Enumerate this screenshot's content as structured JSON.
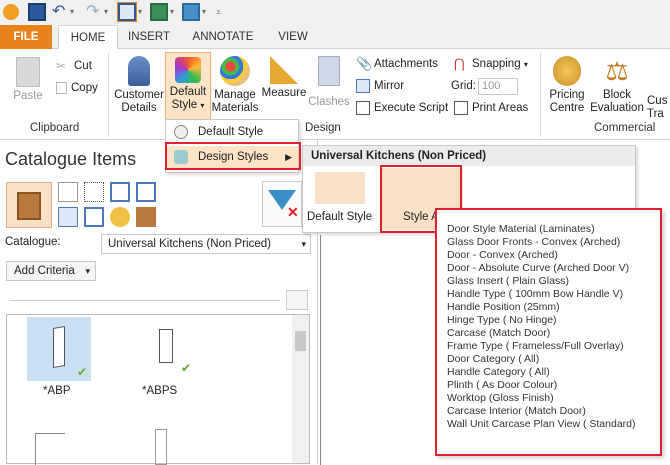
{
  "tabs": [
    "FILE",
    "HOME",
    "INSERT",
    "ANNOTATE",
    "VIEW"
  ],
  "clipboard": {
    "paste": "Paste",
    "cut": "Cut",
    "copy": "Copy",
    "group": "Clipboard"
  },
  "design": {
    "customer": [
      "Customer",
      "Details"
    ],
    "default_style": [
      "Default",
      "Style"
    ],
    "manage": [
      "Manage",
      "Materials"
    ],
    "measure": "Measure",
    "clashes": "Clashes",
    "attachments": "Attachments",
    "mirror": "Mirror",
    "execute": "Execute Script",
    "snapping": "Snapping",
    "grid_label": "Grid:",
    "grid_value": "100",
    "print": "Print Areas",
    "group": "Design"
  },
  "commercial": {
    "pricing": [
      "Pricing",
      "Centre"
    ],
    "block": [
      "Block",
      "Evaluation"
    ],
    "cut_off": [
      "Cus",
      "Tra"
    ],
    "group": "Commercial"
  },
  "left": {
    "title": "Catalogue Items",
    "catalogue_label": "Catalogue:",
    "catalogue_value": "Universal Kitchens (Non Priced)",
    "add_criteria": "Add Criteria",
    "items": [
      "*ABP",
      "*ABPS"
    ]
  },
  "dropdown": {
    "items": [
      "Default Style",
      "Design Styles"
    ]
  },
  "submenu": {
    "title": "Universal Kitchens (Non Priced)",
    "items": [
      "Default Style",
      "Style A"
    ]
  },
  "tooltip": {
    "lines": [
      "Door Style Material (Laminates)",
      "Glass Door Fronts - Convex (Arched)",
      "Door - Convex (Arched)",
      "Door - Absolute Curve (Arched Door V)",
      "Glass Insert (  Plain Glass)",
      "Handle Type ( 100mm Bow Handle V)",
      "Handle Position (25mm)",
      "Hinge Type ( No Hinge)",
      "Carcase (Match Door)",
      "Frame Type ( Frameless/Full Overlay)",
      "Door Category (  All)",
      "Handle Category ( All)",
      "Plinth ( As Door Colour)",
      "Worktop (Gloss Finish)",
      "Carcase Interior (Match Door)",
      "Wall Unit Carcase Plan View ( Standard)"
    ]
  },
  "colors": {
    "accent": "#e8821c",
    "highlight_red": "#e0212c",
    "menu_hover": "#fde3c8"
  }
}
